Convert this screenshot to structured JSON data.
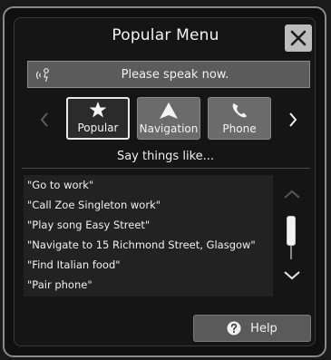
{
  "title": "Popular Menu",
  "voice": {
    "prompt": "Please speak now.",
    "icon": "voice-speaking-icon"
  },
  "categories": [
    {
      "label": "Popular",
      "icon": "star-icon",
      "selected": true
    },
    {
      "label": "Navigation",
      "icon": "navigation-arrow-icon",
      "selected": false
    },
    {
      "label": "Phone",
      "icon": "phone-icon",
      "selected": false
    }
  ],
  "say_things_label": "Say things like...",
  "examples": [
    "\"Go to work\"",
    "\"Call Zoe Singleton work\"",
    "\"Play song Easy Street\"",
    "\"Navigate to 15 Richmond Street, Glasgow\"",
    "\"Find Italian food\"",
    "\"Pair phone\""
  ],
  "help": {
    "label": "Help",
    "icon": "question-circle-icon"
  },
  "colors": {
    "selected_border": "#e8e8e8",
    "button_gray": "#5a5a5a",
    "panel_bg": "#151515"
  }
}
